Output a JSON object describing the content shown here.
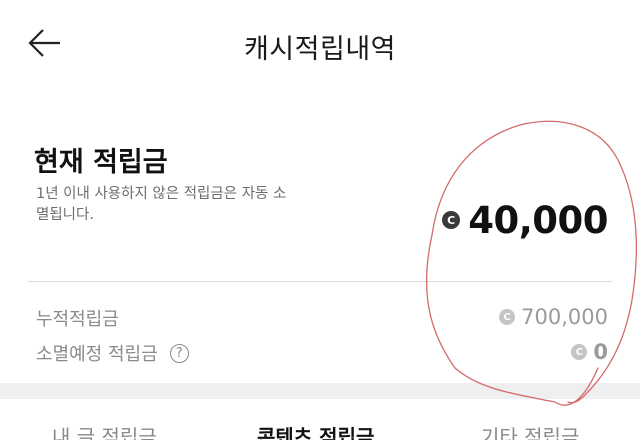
{
  "header": {
    "title": "캐시적립내역"
  },
  "balance": {
    "title": "현재 적립금",
    "description": "1년 이내 사용하지 않은 적립금은 자동 소멸됩니다.",
    "amount": "40,000",
    "coin_symbol": "C"
  },
  "summary": {
    "cumulative_label": "누적적립금",
    "cumulative_value": "700,000",
    "expiring_label": "소멸예정 적립금",
    "expiring_value": "0",
    "help_symbol": "?"
  },
  "tabs": [
    {
      "label": "내 글 적립금"
    },
    {
      "label": "콘텐츠 적립금"
    },
    {
      "label": "기타 적립금"
    }
  ],
  "colors": {
    "annotation_stroke": "#d46a6a"
  }
}
